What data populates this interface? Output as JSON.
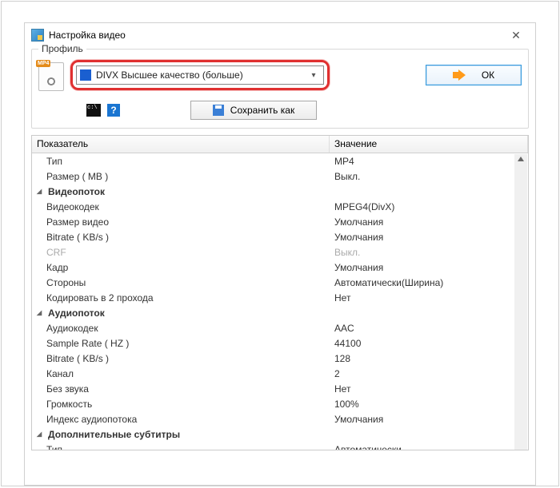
{
  "window": {
    "title": "Настройка видео"
  },
  "profile": {
    "caption": "Профиль",
    "combo": {
      "icon": "divx-icon",
      "text": "DIVX Высшее качество (больше)"
    },
    "ok": "ОК",
    "save_as": "Сохранить как"
  },
  "grid": {
    "header": {
      "name": "Показатель",
      "value": "Значение"
    },
    "rows": [
      {
        "k": "Тип",
        "v": "MP4"
      },
      {
        "k": "Размер ( MB )",
        "v": "Выкл."
      },
      {
        "k": "Видеопоток",
        "group": true
      },
      {
        "k": "Видеокодек",
        "v": "MPEG4(DivX)"
      },
      {
        "k": "Размер видео",
        "v": "Умолчания"
      },
      {
        "k": "Bitrate ( KB/s )",
        "v": "Умолчания"
      },
      {
        "k": "CRF",
        "v": "Выкл.",
        "disabled": true
      },
      {
        "k": "Кадр",
        "v": "Умолчания"
      },
      {
        "k": "Стороны",
        "v": "Автоматически(Ширина)"
      },
      {
        "k": "Кодировать в 2 прохода",
        "v": "Нет"
      },
      {
        "k": "Аудиопоток",
        "group": true
      },
      {
        "k": "Аудиокодек",
        "v": "AAC"
      },
      {
        "k": "Sample Rate ( HZ )",
        "v": "44100"
      },
      {
        "k": "Bitrate ( KB/s )",
        "v": "128"
      },
      {
        "k": "Канал",
        "v": "2"
      },
      {
        "k": "Без звука",
        "v": "Нет"
      },
      {
        "k": "Громкость",
        "v": "100%"
      },
      {
        "k": "Индекс аудиопотока",
        "v": "Умолчания"
      },
      {
        "k": "Дополнительные субтитры",
        "group": true
      },
      {
        "k": "Тип",
        "v": "Автоматически"
      }
    ]
  }
}
